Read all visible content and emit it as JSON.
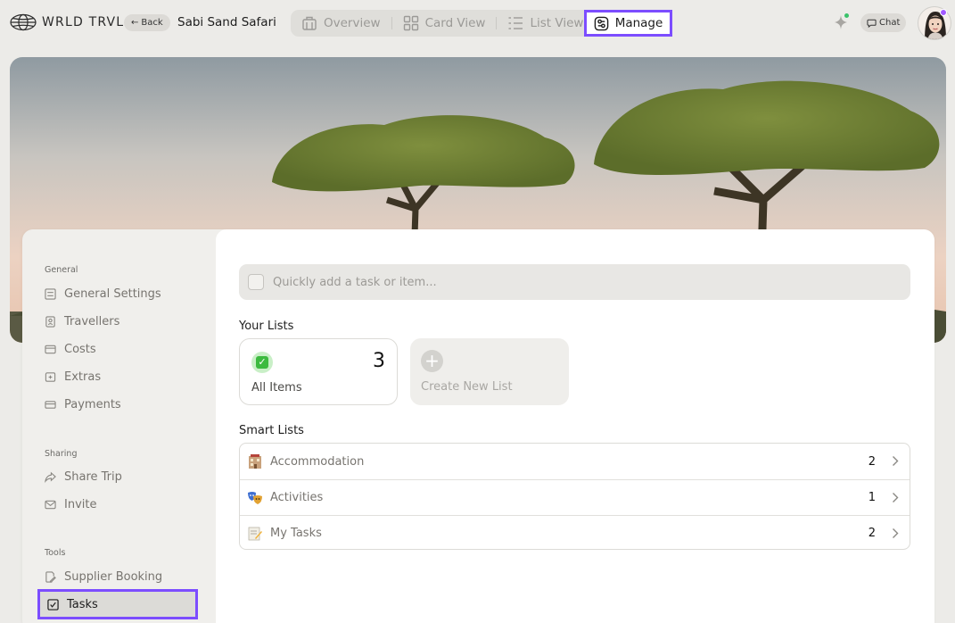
{
  "app": {
    "name": "WRLD TRVL"
  },
  "topbar": {
    "back_label": "Back",
    "trip_title": "Sabi Sand Safari",
    "view_tabs": [
      {
        "label": "Overview",
        "icon": "building-icon"
      },
      {
        "label": "Card View",
        "icon": "grid-icon"
      },
      {
        "label": "List View",
        "icon": "list-icon"
      },
      {
        "label": "Manage",
        "icon": "manage-icon",
        "active": true
      }
    ],
    "chat_label": "Chat"
  },
  "sidebar": {
    "groups": [
      {
        "title": "General",
        "items": [
          "General Settings",
          "Travellers",
          "Costs",
          "Extras",
          "Payments"
        ]
      },
      {
        "title": "Sharing",
        "items": [
          "Share Trip",
          "Invite"
        ]
      },
      {
        "title": "Tools",
        "items": [
          "Supplier Booking",
          "Tasks"
        ]
      }
    ],
    "active_item": "Tasks"
  },
  "main": {
    "quick_add_placeholder": "Quickly add a task or item...",
    "your_lists_heading": "Your Lists",
    "lists": [
      {
        "label": "All Items",
        "count": "3",
        "icon": "checkbox-emoji-icon"
      },
      {
        "label": "Create New List",
        "icon": "plus-icon"
      }
    ],
    "smart_lists_heading": "Smart Lists",
    "smart_lists": [
      {
        "label": "Accommodation",
        "count": "2",
        "icon": "hotel-emoji-icon"
      },
      {
        "label": "Activities",
        "count": "1",
        "icon": "masks-emoji-icon"
      },
      {
        "label": "My Tasks",
        "count": "2",
        "icon": "memo-emoji-icon"
      }
    ]
  },
  "colors": {
    "accent": "#7c4dff",
    "background": "#ecebe8",
    "panel": "#f0efec"
  }
}
